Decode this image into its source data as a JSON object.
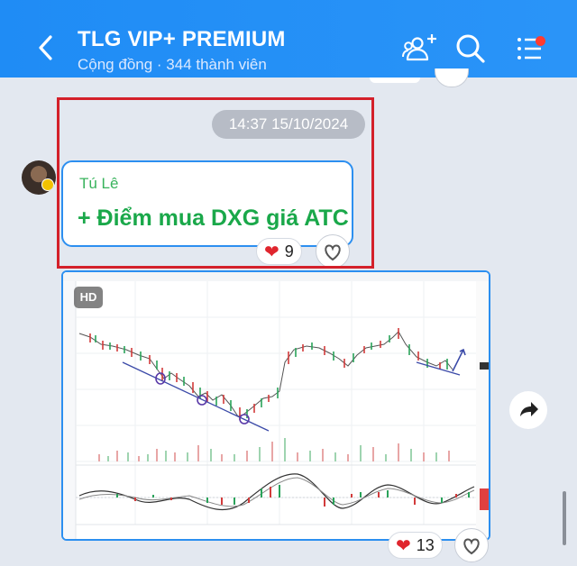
{
  "header": {
    "title": "TLG VIP+ PREMIUM",
    "subtitle": "Cộng đồng · 344 thành viên",
    "back_icon": "chevron-left-icon",
    "add_member_icon": "add-members-icon",
    "search_icon": "search-icon",
    "menu_icon": "menu-icon",
    "accent": "#1f8cf5",
    "badge_color": "#ff3b30"
  },
  "message": {
    "timestamp": "14:37 15/10/2024",
    "sender": "Tú Lê",
    "text": "+ Điểm mua DXG giá ATC",
    "reaction_count": "9",
    "reaction_icon": "heart-icon",
    "text_color": "#1aa84a",
    "highlight_color": "#d4202a"
  },
  "image_message": {
    "quality_badge": "HD",
    "reaction_count": "13",
    "content": "stock-chart-screenshot"
  },
  "actions": {
    "share_icon": "share-forward-icon"
  }
}
